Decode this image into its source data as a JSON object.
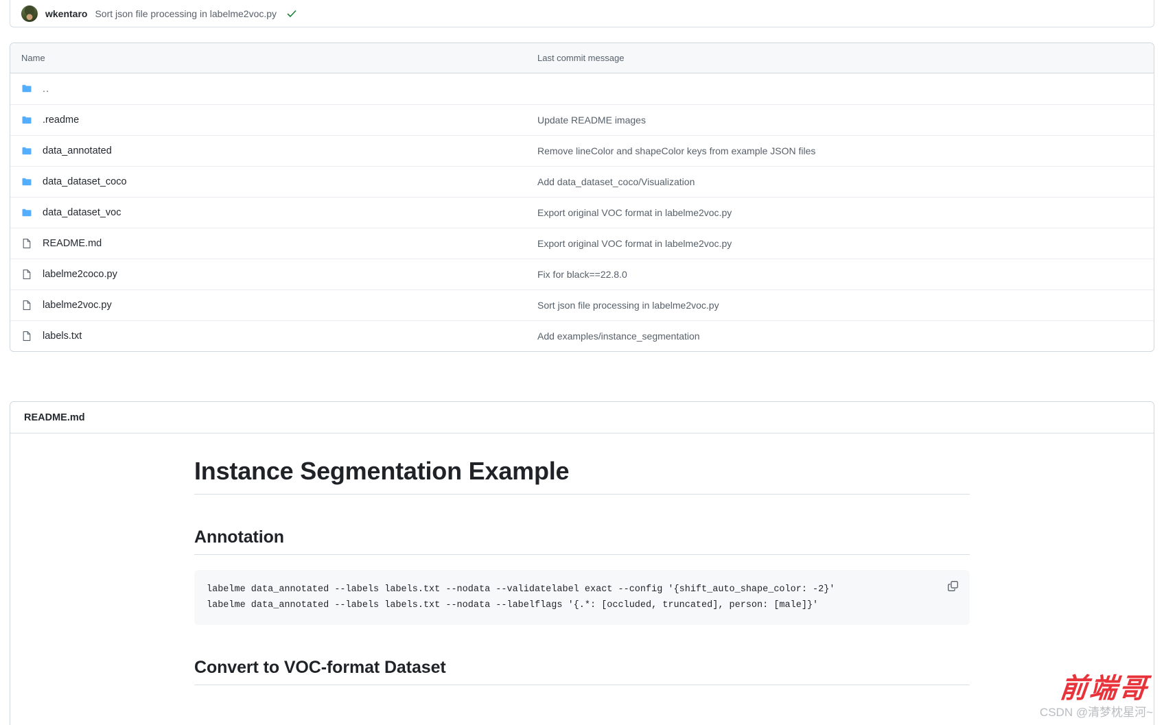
{
  "commit_bar": {
    "author": "wkentaro",
    "message": "Sort json file processing in labelme2voc.py",
    "status_icon": "check-icon"
  },
  "file_table": {
    "columns": {
      "name": "Name",
      "last_commit_message": "Last commit message"
    },
    "rows": [
      {
        "icon": "folder-icon",
        "name": "..",
        "message": ""
      },
      {
        "icon": "folder-icon",
        "name": ".readme",
        "message": "Update README images"
      },
      {
        "icon": "folder-icon",
        "name": "data_annotated",
        "message": "Remove lineColor and shapeColor keys from example JSON files"
      },
      {
        "icon": "folder-icon",
        "name": "data_dataset_coco",
        "message": "Add data_dataset_coco/Visualization"
      },
      {
        "icon": "folder-icon",
        "name": "data_dataset_voc",
        "message": "Export original VOC format in labelme2voc.py"
      },
      {
        "icon": "file-icon",
        "name": "README.md",
        "message": "Export original VOC format in labelme2voc.py"
      },
      {
        "icon": "file-icon",
        "name": "labelme2coco.py",
        "message": "Fix for black==22.8.0"
      },
      {
        "icon": "file-icon",
        "name": "labelme2voc.py",
        "message": "Sort json file processing in labelme2voc.py"
      },
      {
        "icon": "file-icon",
        "name": "labels.txt",
        "message": "Add examples/instance_segmentation"
      }
    ]
  },
  "readme": {
    "header_title": "README.md",
    "h1": "Instance Segmentation Example",
    "section_annotation": {
      "heading": "Annotation",
      "copy_icon": "copy-icon",
      "code_lines": [
        "labelme data_annotated --labels labels.txt --nodata --validatelabel exact --config '{shift_auto_shape_color: -2}'",
        "labelme data_annotated --labels labels.txt --nodata --labelflags '{.*: [occluded, truncated], person: [male]}'"
      ]
    },
    "section_convert": {
      "heading": "Convert to VOC-format Dataset"
    }
  },
  "watermark": {
    "cn_text": "前端哥",
    "sub_text": "CSDN @清梦枕星河~"
  },
  "colors": {
    "folder_blue": "#54aeff",
    "link_blue": "#0969da",
    "muted_text": "#57606a",
    "strong_text": "#24292f",
    "check_green": "#1a7f37",
    "border": "#d0d7de",
    "header_bg": "#f6f8fa",
    "watermark_red": "#e8333a"
  }
}
